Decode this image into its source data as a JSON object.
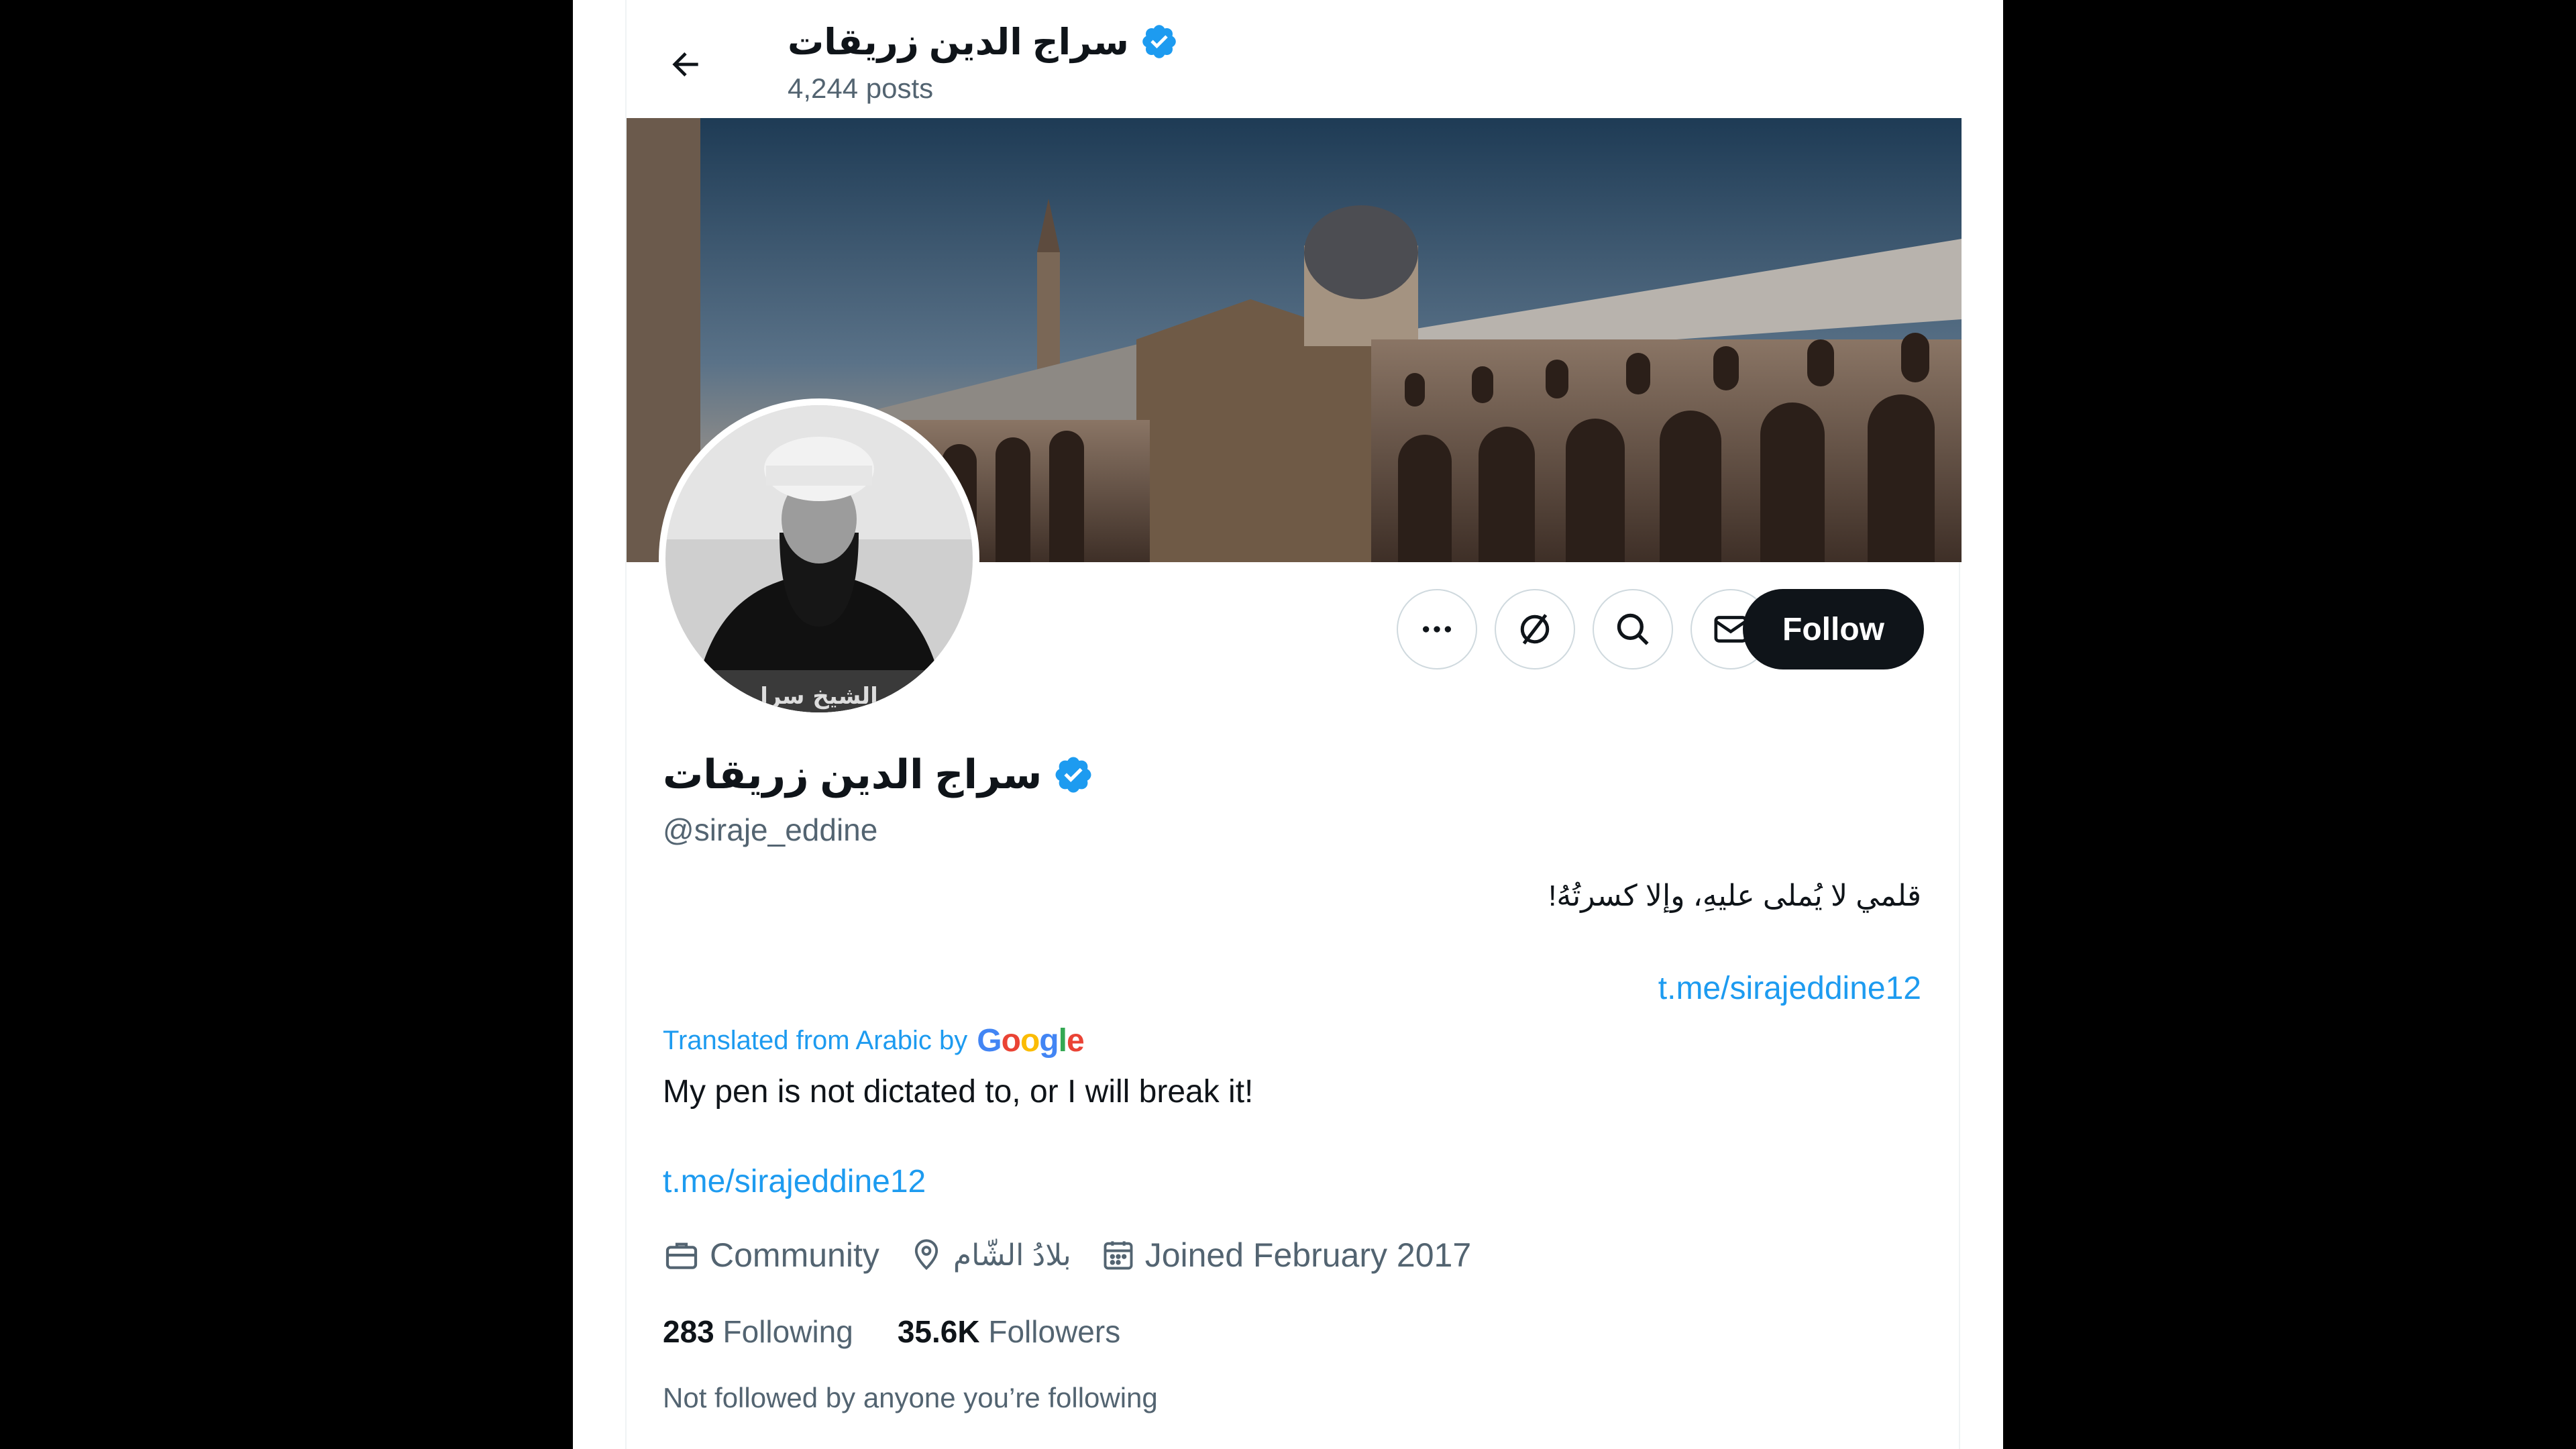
{
  "header": {
    "name": "سراج الدين زريقات",
    "posts": "4,244 posts"
  },
  "profile": {
    "name": "سراج الدين زريقات",
    "handle": "@siraje_eddine",
    "bio_original": "قلمي لا يُملى عليهِ، وإلا كسرتُهُ!",
    "link_original": "t.me/sirajeddine12",
    "translated_label": "Translated from Arabic by",
    "translator_brand": "Google",
    "bio_translated": "My pen is not dictated to, or I will break it!",
    "link_translated": "t.me/sirajeddine12",
    "category": "Community",
    "location": "بلادُ الشّام",
    "joined": "Joined February 2017",
    "following_count": "283",
    "following_label": "Following",
    "followers_count": "35.6K",
    "followers_label": "Followers",
    "not_followed_note": "Not followed by anyone you’re following",
    "avatar_caption": "الشيخ سرا"
  },
  "actions": {
    "follow_label": "Follow",
    "icons": [
      "more-icon",
      "subscribe-icon",
      "search-icon",
      "message-icon"
    ]
  },
  "colors": {
    "accent": "#1d9bf0",
    "text": "#0f1419",
    "secondary": "#536471",
    "verified": "#1d9bf0"
  }
}
